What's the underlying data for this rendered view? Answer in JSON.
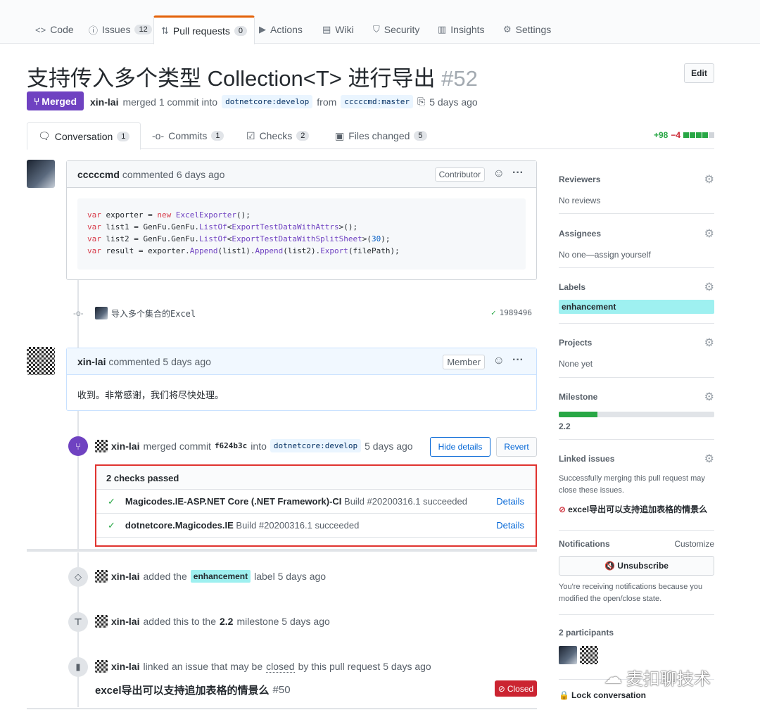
{
  "repo_nav": {
    "tabs": [
      {
        "icon": "code-icon",
        "glyph": "<>",
        "label": "Code",
        "count": ""
      },
      {
        "icon": "issue-icon",
        "glyph": "ⓘ",
        "label": "Issues",
        "count": "12"
      },
      {
        "icon": "pull-request-icon",
        "glyph": "⇅",
        "label": "Pull requests",
        "count": "0"
      },
      {
        "icon": "play-icon",
        "glyph": "▶",
        "label": "Actions",
        "count": ""
      },
      {
        "icon": "book-icon",
        "glyph": "▤",
        "label": "Wiki",
        "count": ""
      },
      {
        "icon": "shield-icon",
        "glyph": "⛉",
        "label": "Security",
        "count": ""
      },
      {
        "icon": "graph-icon",
        "glyph": "▥",
        "label": "Insights",
        "count": ""
      },
      {
        "icon": "gear-icon",
        "glyph": "⚙",
        "label": "Settings",
        "count": ""
      }
    ]
  },
  "pr": {
    "title": "支持传入多个类型 Collection<T> 进行导出",
    "number": "#52",
    "edit_label": "Edit",
    "status": "Merged",
    "author": "xin-lai",
    "merged_text": "merged 1 commit into",
    "base_branch": "dotnetcore:develop",
    "from_text": "from",
    "head_branch": "cccccmd:master",
    "time": "5 days ago"
  },
  "pr_tabs": [
    {
      "icon": "conversation-icon",
      "label": "Conversation",
      "count": "1"
    },
    {
      "icon": "commit-icon",
      "label": "Commits",
      "count": "1"
    },
    {
      "icon": "checks-icon",
      "label": "Checks",
      "count": "2"
    },
    {
      "icon": "file-diff-icon",
      "label": "Files changed",
      "count": "5"
    }
  ],
  "diffstat": {
    "added": "+98",
    "removed": "−4"
  },
  "comment1": {
    "author": "cccccmd",
    "action": "commented 6 days ago",
    "role": "Contributor",
    "code": [
      "var exporter = new ExcelExporter();",
      "var list1 = GenFu.GenFu.ListOf<ExportTestDataWithAttrs>();",
      "var list2 = GenFu.GenFu.ListOf<ExportTestDataWithSplitSheet>(30);",
      "var result = exporter.Append(list1).Append(list2).Export(filePath);"
    ]
  },
  "commit": {
    "message": "导入多个集合的Excel",
    "sha": "1989496"
  },
  "comment2": {
    "author": "xin-lai",
    "action": "commented 5 days ago",
    "role": "Member",
    "body": "收到。非常感谢，我们将尽快处理。"
  },
  "merge_event": {
    "author": "xin-lai",
    "text": "merged commit",
    "sha": "f624b3c",
    "into": "into",
    "branch": "dotnetcore:develop",
    "time": "5 days ago",
    "hide_details": "Hide details",
    "revert": "Revert",
    "checks_header": "2 checks passed",
    "checks": [
      {
        "name": "Magicodes.IE-ASP.NET Core (.NET Framework)-CI",
        "status": "Build #20200316.1 succeeded",
        "link": "Details"
      },
      {
        "name": "dotnetcore.Magicodes.IE",
        "status": "Build #20200316.1 succeeded",
        "link": "Details"
      }
    ]
  },
  "events": {
    "label_event": {
      "author": "xin-lai",
      "pre": "added the",
      "label": "enhancement",
      "post": "label 5 days ago"
    },
    "milestone_event": {
      "author": "xin-lai",
      "pre": "added this to the",
      "milestone": "2.2",
      "post": "milestone 5 days ago"
    },
    "link_event": {
      "author": "xin-lai",
      "pre": "linked an issue that may be",
      "closed_word": "closed",
      "post": "by this pull request 5 days ago"
    },
    "linked_issue": {
      "title": "excel导出可以支持追加表格的情景么",
      "number": "#50",
      "state": "Closed"
    }
  },
  "sidebar": {
    "reviewers": {
      "title": "Reviewers",
      "value": "No reviews"
    },
    "assignees": {
      "title": "Assignees",
      "value": "No one—assign yourself"
    },
    "labels": {
      "title": "Labels",
      "value": "enhancement"
    },
    "projects": {
      "title": "Projects",
      "value": "None yet"
    },
    "milestone": {
      "title": "Milestone",
      "value": "2.2",
      "progress": 0.25
    },
    "linked_issues": {
      "title": "Linked issues",
      "desc": "Successfully merging this pull request may close these issues.",
      "issue": "excel导出可以支持追加表格的情景么"
    },
    "notifications": {
      "title": "Notifications",
      "customize": "Customize",
      "button": "Unsubscribe",
      "desc": "You're receiving notifications because you modified the open/close state."
    },
    "participants": {
      "title": "2 participants"
    },
    "lock": "Lock conversation"
  },
  "watermark": "麦扣聊技术",
  "colors": {
    "merged": "#6f42c1",
    "accent": "#e36209",
    "success": "#28a745",
    "closed": "#cb2431",
    "label": "#9ef0f0",
    "link": "#0366d6"
  }
}
